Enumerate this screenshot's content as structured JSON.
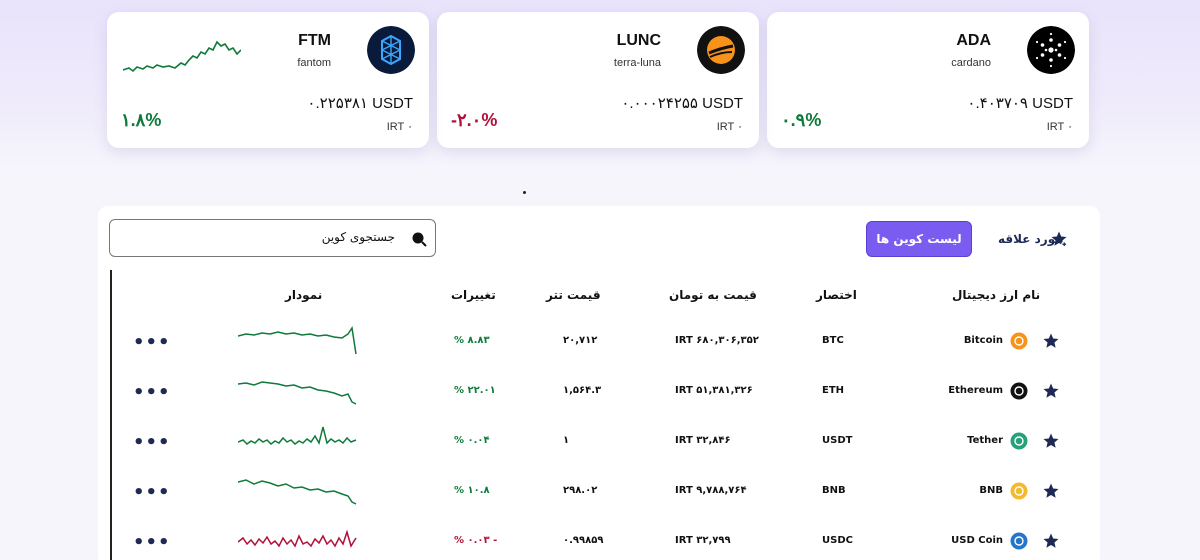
{
  "top_cards": [
    {
      "symbol": "ADA",
      "slug": "cardano",
      "price": "۰.۴۰۳۷۰۹ USDT",
      "irt": "IRT ۰",
      "change": "۰.۹%",
      "trend": "up",
      "logo_color": "#000000"
    },
    {
      "symbol": "LUNC",
      "slug": "terra-luna",
      "price": "۰.۰۰۰۲۴۲۵۵ USDT",
      "irt": "IRT ۰",
      "change": "-۲.۰%",
      "trend": "down",
      "logo_color": "#111111"
    },
    {
      "symbol": "FTM",
      "slug": "fantom",
      "price": "۰.۲۲۵۳۸۱ USDT",
      "irt": "IRT ۰",
      "change": "۱.۸%",
      "trend": "up",
      "logo_color": "#0a1a3a"
    }
  ],
  "toolbar": {
    "favorites_label": "مورد علاقه",
    "coin_list_label": "لیست کوین ها",
    "search_placeholder": "جستجوی کوین"
  },
  "table": {
    "headers": {
      "name": "نام ارز دیجیتال",
      "abbr": "اختصار",
      "toman": "قیمت به تومان",
      "tether": "قیمت تتر",
      "change": "تغییرات",
      "chart": "نمودار"
    },
    "rows": [
      {
        "name": "Bitcoin",
        "abbr": "BTC",
        "toman": "IRT ۶۸۰,۳۰۶,۳۵۲",
        "tether": "۲۰,۷۱۲",
        "change": "% ۸.۸۳",
        "trend": "up",
        "icon": "bitcoin-icon",
        "icon_color": "#f7931a"
      },
      {
        "name": "Ethereum",
        "abbr": "ETH",
        "toman": "IRT ۵۱,۳۸۱,۳۲۶",
        "tether": "۱,۵۶۴.۳",
        "change": "% ۲۲.۰۱",
        "trend": "up",
        "icon": "ethereum-icon",
        "icon_color": "#111111"
      },
      {
        "name": "Tether",
        "abbr": "USDT",
        "toman": "IRT ۳۲,۸۴۶",
        "tether": "۱",
        "change": "% ۰.۰۴",
        "trend": "up",
        "icon": "tether-icon",
        "icon_color": "#26a17b"
      },
      {
        "name": "BNB",
        "abbr": "BNB",
        "toman": "IRT ۹,۷۸۸,۷۶۴",
        "tether": "۲۹۸.۰۲",
        "change": "% ۱۰.۸",
        "trend": "up",
        "icon": "bnb-icon",
        "icon_color": "#f3ba2f"
      },
      {
        "name": "USD Coin",
        "abbr": "USDC",
        "toman": "IRT ۳۲,۷۹۹",
        "tether": "۰.۹۹۸۵۹",
        "change": "% ۰.۰۳ -",
        "trend": "down",
        "icon": "usdc-icon",
        "icon_color": "#2775ca"
      }
    ]
  },
  "colors": {
    "accent": "#7b5cf0",
    "up": "#0d7a3a",
    "down": "#b0103a",
    "star": "#1e2a56"
  }
}
